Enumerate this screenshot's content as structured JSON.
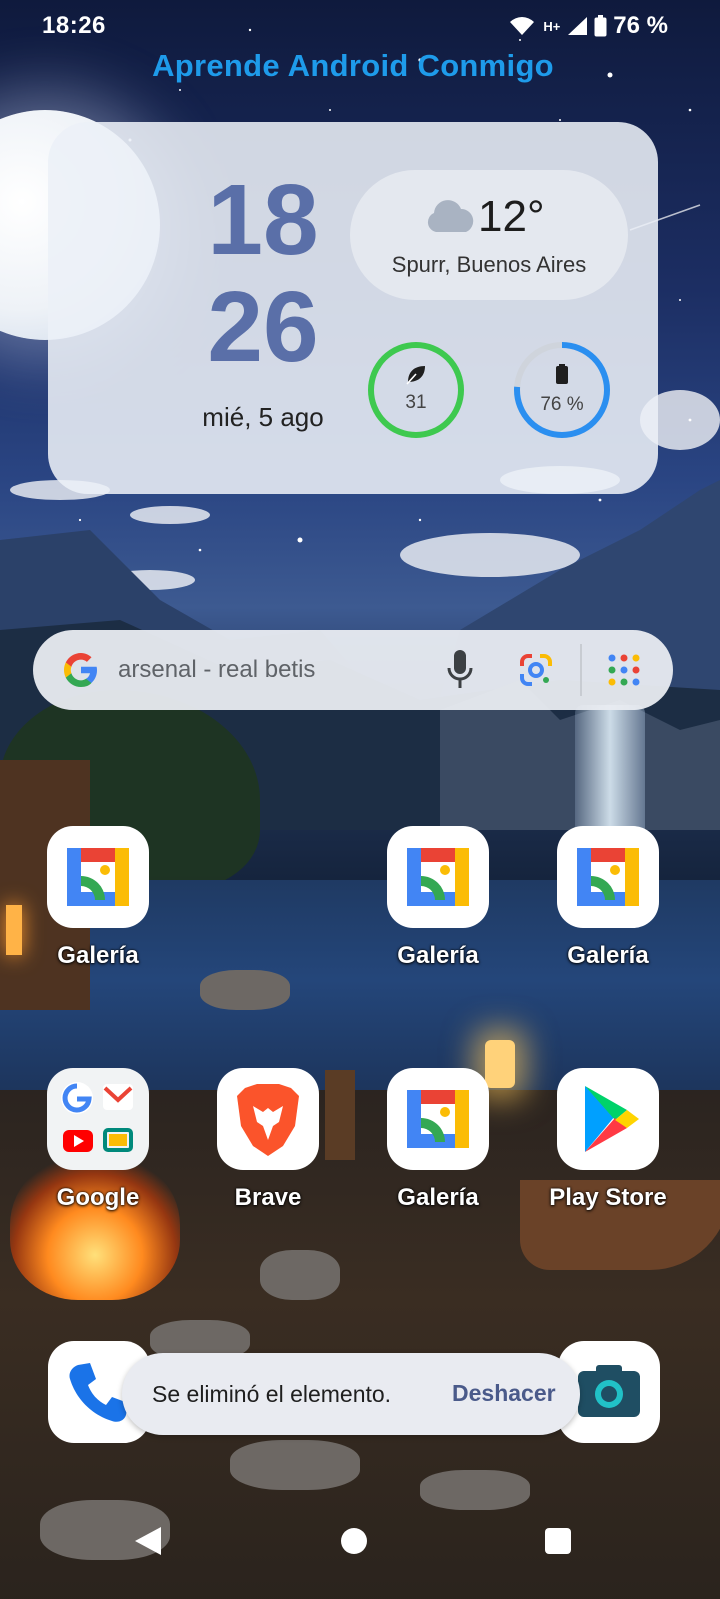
{
  "status_bar": {
    "time": "18:26",
    "network_type": "H+",
    "battery_percent": "76 %"
  },
  "banner": {
    "title": "Aprende Android Conmigo",
    "color": "#1e9bea"
  },
  "clock_widget": {
    "hour": "18",
    "minute": "26",
    "date": "mié, 5 ago",
    "weather": {
      "temperature": "12°",
      "location": "Spurr, Buenos Aires",
      "icon": "cloud-icon"
    },
    "air_quality": {
      "value": "31",
      "icon": "leaf-icon",
      "ring_color": "#3ec94f",
      "level": 1.0
    },
    "battery": {
      "value": "76 %",
      "icon": "battery-icon",
      "ring_color": "#2b8ff0",
      "level": 0.76
    }
  },
  "search": {
    "query": "arsenal - real betis",
    "icons": [
      "google-logo-icon",
      "mic-icon",
      "lens-icon",
      "apps-grid-icon"
    ]
  },
  "apps_row1": [
    {
      "label": "Galería",
      "icon": "gallery-icon"
    },
    {
      "label": "Galería",
      "icon": "gallery-icon"
    },
    {
      "label": "Galería",
      "icon": "gallery-icon"
    }
  ],
  "apps_row2": [
    {
      "label": "Google",
      "icon": "google-folder-icon"
    },
    {
      "label": "Brave",
      "icon": "brave-lion-icon"
    },
    {
      "label": "Galería",
      "icon": "gallery-icon"
    },
    {
      "label": "Play Store",
      "icon": "play-store-icon"
    }
  ],
  "dock": [
    {
      "icon": "phone-icon"
    },
    {
      "icon": "camera-icon"
    }
  ],
  "snackbar": {
    "message": "Se eliminó el elemento.",
    "action": "Deshacer"
  },
  "nav": {
    "icons": [
      "back-icon",
      "home-icon",
      "recents-icon"
    ]
  }
}
